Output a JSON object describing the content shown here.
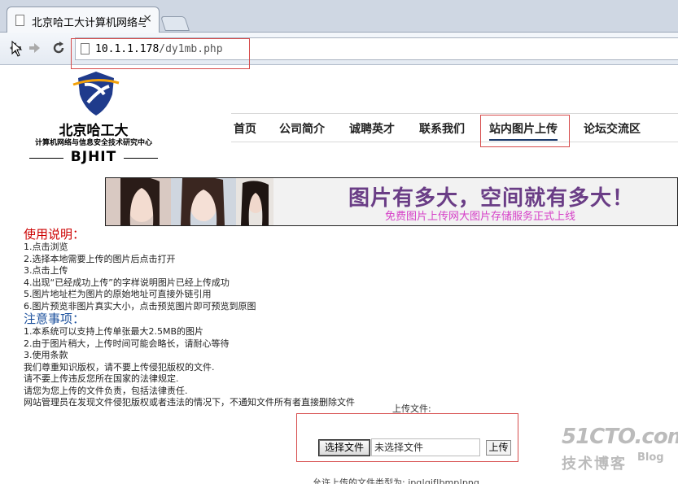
{
  "browser": {
    "tab_title": "北京哈工大计算机网络与信",
    "tab_close": "×",
    "url_host": "10.1.1.178",
    "url_path": "/dy1mb.php",
    "back_icon": "back-arrow-icon",
    "forward_icon": "forward-arrow-icon",
    "reload_icon": "reload-icon"
  },
  "logo": {
    "title": "北京哈工大",
    "subtitle": "计算机网络与信息安全技术研究中心",
    "mark": "BJHIT"
  },
  "nav": {
    "items": [
      "首页",
      "公司简介",
      "诚聘英才",
      "联系我们",
      "站内图片上传",
      "论坛交流区"
    ],
    "active_index": 4
  },
  "banner": {
    "headline": "图片有多大，空间就有多大！",
    "tagline": "免费图片上传网大图片存储服务正式上线"
  },
  "instructions": {
    "heading": "使用说明：",
    "lines": [
      "1.点击浏览",
      "2.选择本地需要上传的图片后点击打开",
      "3.点击上传",
      "4.出现“已经成功上传”的字样说明图片已经上传成功",
      "5.图片地址栏为图片的原始地址可直接外链引用",
      "6.图片预览非图片真实大小，点击预览图片即可预览到原图"
    ]
  },
  "notes": {
    "heading": "注意事项：",
    "lines": [
      "1.本系统可以支持上传单张最大2.5MB的图片",
      "2.由于图片稍大，上传时间可能会略长，请耐心等待",
      "3.使用条款",
      "我们尊重知识版权，请不要上传侵犯版权的文件.",
      "请不要上传违反您所在国家的法律规定.",
      "请您为您上传的文件负责，包括法律责任.",
      "网站管理员在发现文件侵犯版权或者违法的情况下，不通知文件所有者直接删除文件"
    ]
  },
  "upload": {
    "label": "上传文件:",
    "choose_button": "选择文件",
    "file_status": "未选择文件",
    "submit_button": "上传",
    "bottom_text": "允许上传的文件类型为: jpg|gif|bmp|png"
  },
  "watermark": {
    "top": "51CTO.com",
    "bottom": "技术博客",
    "blog": "Blog"
  },
  "colors": {
    "highlight_box": "#d64b4b",
    "heading_red": "#cc0000",
    "heading_blue": "#1a4f9c",
    "banner_purple": "#6a3d86",
    "banner_pink": "#d640c8"
  }
}
